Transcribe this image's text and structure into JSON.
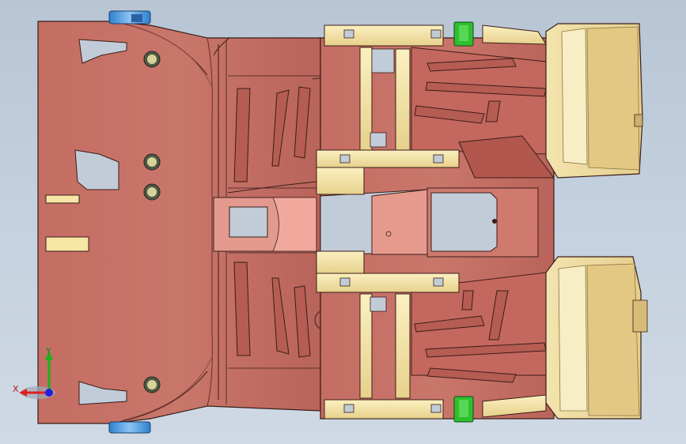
{
  "viewport": {
    "background_top": "#b7c5d5",
    "background_bottom": "#cfd9e4"
  },
  "model": {
    "body_color": "#c9736a",
    "rail_color": "#f1e2a8",
    "clip_color": "#2fbf2f",
    "mount_color": "#4f9fe0",
    "cutout_color": "#c2ccd8"
  },
  "triad": {
    "x_label": "X",
    "y_label": "Y",
    "x_color": "#e02020",
    "y_color": "#20b020",
    "z_color": "#2020e0"
  }
}
